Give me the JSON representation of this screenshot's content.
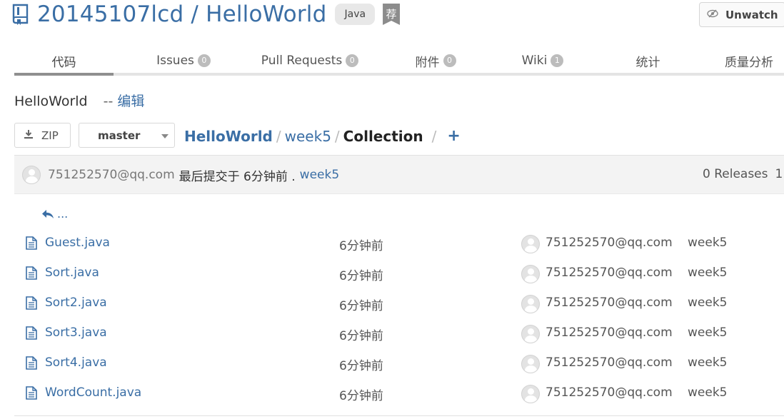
{
  "header": {
    "repo_title": "20145107lcd / HelloWorld",
    "language_badge": "Java",
    "recommend_badge": "荐",
    "unwatch_label": "Unwatch"
  },
  "tabs": [
    {
      "label": "代码",
      "count": null
    },
    {
      "label": "Issues",
      "count": "0"
    },
    {
      "label": "Pull Requests",
      "count": "0"
    },
    {
      "label": "附件",
      "count": "0"
    },
    {
      "label": "Wiki",
      "count": "1"
    },
    {
      "label": "统计",
      "count": null
    },
    {
      "label": "质量分析",
      "count": null
    }
  ],
  "description": {
    "text": "HelloWorld",
    "separator": "--",
    "edit_label": "编辑"
  },
  "toolbar": {
    "zip_label": "ZIP",
    "branch": "master"
  },
  "breadcrumb": {
    "root": "HelloWorld",
    "folder": "week5",
    "current": "Collection",
    "add_label": "+"
  },
  "commit": {
    "author": "751252570@qq.com",
    "message": "最后提交于 6分钟前 .",
    "ref": "week5",
    "releases": "0 Releases",
    "releases_extra": "1"
  },
  "file_list": {
    "parent_label": "...",
    "files": [
      {
        "name": "Guest.java",
        "time": "6分钟前",
        "author": "751252570@qq.com",
        "message": "week5"
      },
      {
        "name": "Sort.java",
        "time": "6分钟前",
        "author": "751252570@qq.com",
        "message": "week5"
      },
      {
        "name": "Sort2.java",
        "time": "6分钟前",
        "author": "751252570@qq.com",
        "message": "week5"
      },
      {
        "name": "Sort3.java",
        "time": "6分钟前",
        "author": "751252570@qq.com",
        "message": "week5"
      },
      {
        "name": "Sort4.java",
        "time": "6分钟前",
        "author": "751252570@qq.com",
        "message": "week5"
      },
      {
        "name": "WordCount.java",
        "time": "6分钟前",
        "author": "751252570@qq.com",
        "message": "week5"
      }
    ]
  },
  "colors": {
    "link": "#3a6ea5",
    "tab_active": "#8f8f8f",
    "commit_bar": "#f3f3f3"
  }
}
